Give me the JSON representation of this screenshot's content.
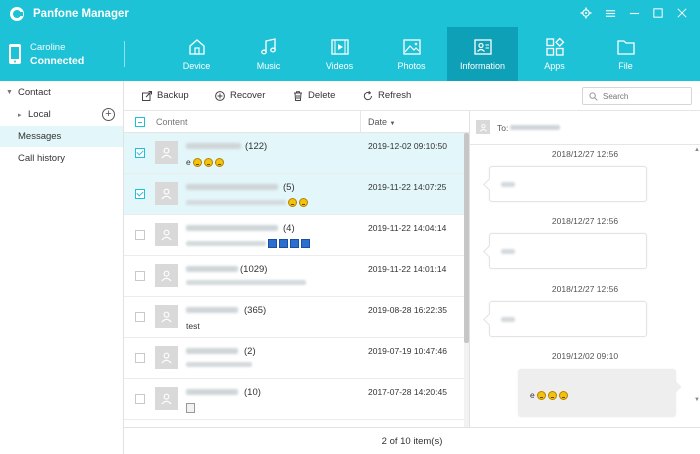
{
  "app": {
    "title": "Panfone Manager"
  },
  "window_controls": [
    "gear-icon",
    "menu-icon",
    "minimize-icon",
    "maximize-icon",
    "close-icon"
  ],
  "device": {
    "name": "Caroline",
    "status": "Connected"
  },
  "nav": {
    "tabs": [
      {
        "label": "Device",
        "icon": "home-icon"
      },
      {
        "label": "Music",
        "icon": "music-icon"
      },
      {
        "label": "Videos",
        "icon": "video-icon"
      },
      {
        "label": "Photos",
        "icon": "photo-icon"
      },
      {
        "label": "Information",
        "icon": "contact-card-icon",
        "active": true
      },
      {
        "label": "Apps",
        "icon": "apps-icon"
      },
      {
        "label": "File",
        "icon": "folder-icon"
      }
    ]
  },
  "sidebar": {
    "contact": "Contact",
    "local": "Local",
    "messages": "Messages",
    "call_history": "Call history"
  },
  "toolbar": {
    "backup": "Backup",
    "recover": "Recover",
    "delete": "Delete",
    "refresh": "Refresh",
    "search_placeholder": "Search"
  },
  "list": {
    "col_content": "Content",
    "col_date": "Date",
    "rows": [
      {
        "count": "(122)",
        "date": "2019-12-02 09:10:50",
        "selected": true,
        "preview_text": "e",
        "emojis": 3
      },
      {
        "count": "(5)",
        "date": "2019-11-22 14:07:25",
        "selected": true,
        "preview_text": "",
        "emojis": 2
      },
      {
        "count": "(4)",
        "date": "2019-11-22 14:04:14",
        "selected": false,
        "preview_text": "",
        "squares": 4
      },
      {
        "count": "(1029)",
        "date": "2019-11-22 14:01:14",
        "selected": false,
        "preview_text": ""
      },
      {
        "count": "(365)",
        "date": "2019-08-28 16:22:35",
        "selected": false,
        "preview_text": "test"
      },
      {
        "count": "(2)",
        "date": "2019-07-19 10:47:46",
        "selected": false,
        "preview_text": ""
      },
      {
        "count": "(10)",
        "date": "2017-07-28 14:20:45",
        "selected": false,
        "preview_text": "",
        "attachment": true
      }
    ]
  },
  "conversation": {
    "to_label": "To:",
    "stamps": [
      "2018/12/27 12:56",
      "2018/12/27 12:56",
      "2018/12/27 12:56",
      "2019/12/02 09:10"
    ],
    "last_message_text": "e"
  },
  "status": {
    "text": "2 of 10 item(s)"
  }
}
